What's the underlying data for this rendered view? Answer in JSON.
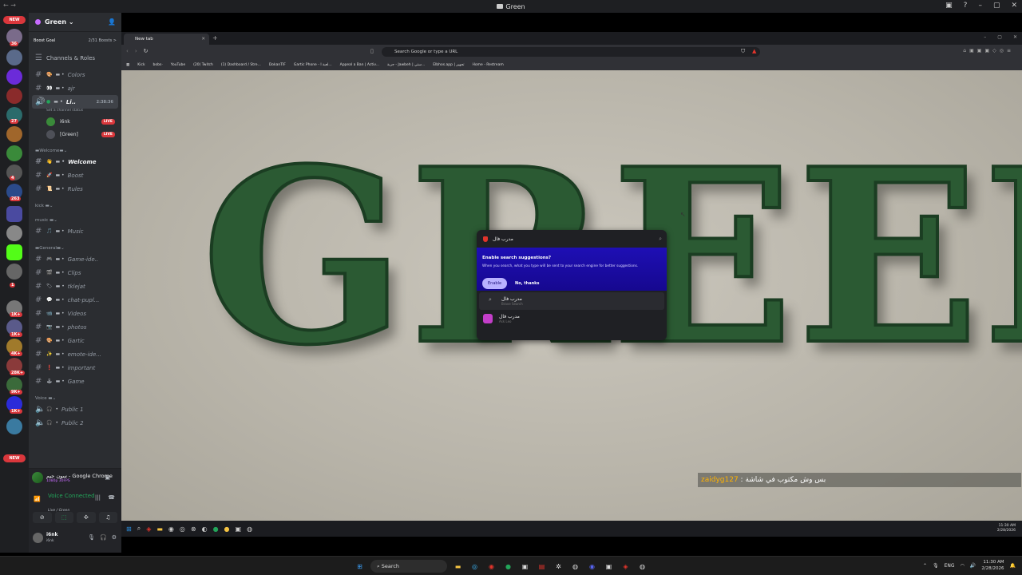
{
  "window": {
    "title": "Green"
  },
  "server": {
    "name": "Green",
    "boost_label": "Boost Goal",
    "boost_count": "2/31 Boosts >"
  },
  "rail": {
    "new_top": "NEW",
    "new_bottom": "NEW",
    "badges": [
      "36",
      "27",
      "4",
      "263",
      "1",
      "1K+",
      "1K+",
      "4K+",
      "28K+",
      "9K+",
      "1K+"
    ]
  },
  "channels": {
    "roles": "Channels & Roles",
    "top": [
      {
        "name": "Colors",
        "emoji": "🎨"
      },
      {
        "name": "ajr",
        "emoji": "👀"
      }
    ],
    "live": {
      "name": "Li..",
      "time": "2:38:36",
      "status": "Set a channel status"
    },
    "live_users": [
      {
        "name": "i6nk",
        "badge": "LIVE"
      },
      {
        "name": "[Green]",
        "badge": "LIVE"
      }
    ],
    "cat_welcome": "Welcome",
    "welcome": [
      {
        "name": "Welcome",
        "emoji": "👋"
      },
      {
        "name": "Boost",
        "emoji": "🚀"
      },
      {
        "name": "Rules",
        "emoji": "📜"
      }
    ],
    "cat_kick": "kick",
    "cat_music": "music",
    "music": [
      {
        "name": "Music",
        "emoji": "🎵"
      }
    ],
    "cat_general": "General",
    "general": [
      {
        "name": "Game-ide..",
        "emoji": "🎮"
      },
      {
        "name": "Clips",
        "emoji": "🎬"
      },
      {
        "name": "tklejat",
        "emoji": "🏷"
      },
      {
        "name": "chat-pupl...",
        "emoji": "💬"
      },
      {
        "name": "Videos",
        "emoji": "📹"
      },
      {
        "name": "photos",
        "emoji": "📷"
      },
      {
        "name": "Gartic",
        "emoji": "🎨"
      },
      {
        "name": "emote-ide...",
        "emoji": "✨"
      },
      {
        "name": "important",
        "emoji": "❗"
      },
      {
        "name": "Game",
        "emoji": "🕹"
      }
    ],
    "cat_voice": "Voice",
    "voice": [
      {
        "name": "Public 1"
      },
      {
        "name": "Public 2"
      }
    ]
  },
  "rtc": {
    "stream_title": "سون جيم - Google Chrome",
    "stream_sub": "1080p 30FPS",
    "voice_connected": "Voice Connected",
    "voice_path": "Live / Green"
  },
  "user": {
    "name": "i6nk",
    "status": "i6nk"
  },
  "browser": {
    "tab_title": "New tab",
    "omnibox_placeholder": "Search Google or type a URL",
    "bookmarks": [
      "Kick",
      "bobs·",
      "YouTube",
      "(20) Twitch",
      "(1) Dashboard / Stre...",
      "DokanTIF",
      "Gartic Phone - لعبة ا...",
      "Appeal a Ban | Activ...",
      "جربة - Jawbeh | ستي...",
      "Elbhos.app | تجهيز",
      "Home - Restream"
    ]
  },
  "page": {
    "headline": "GREEN"
  },
  "popup": {
    "query": "مدرب فال",
    "title": "Enable search suggestions?",
    "desc": "When you search, what you type will be sent to your search engine for better suggestions.",
    "enable": "Enable",
    "no_thanks": "No, thanks",
    "suggestions": [
      {
        "text": "مدرب فال",
        "sub": "Brave Search"
      },
      {
        "text": "مدرب فال",
        "sub": "Ask Leo"
      }
    ]
  },
  "chat": {
    "user": "zaidyg127",
    "sep": " : ",
    "msg": "بس وش مكتوب في شاشة"
  },
  "inner_taskbar": {
    "time": "11:30 AM",
    "date": "2/28/2026"
  },
  "taskbar": {
    "search": "Search",
    "lang": "ENG",
    "time": "11:30 AM",
    "date": "2/28/2026"
  }
}
